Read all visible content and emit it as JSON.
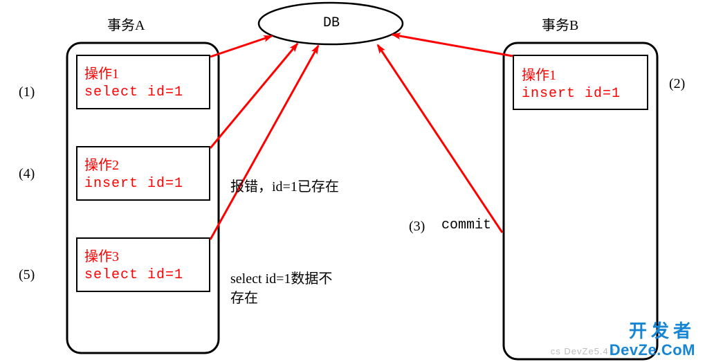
{
  "db": {
    "label": "DB"
  },
  "transaction_a": {
    "title": "事务A",
    "operations": [
      {
        "title": "操作1",
        "code": "select  id=1",
        "step_label": "(1)"
      },
      {
        "title": "操作2",
        "code": "insert  id=1",
        "step_label": "(4)",
        "annotation": "报错，id=1已存在"
      },
      {
        "title": "操作3",
        "code": "select  id=1",
        "step_label": "(5)",
        "annotation_lines": [
          "select id=1数据不",
          "存在"
        ]
      }
    ]
  },
  "transaction_b": {
    "title": "事务B",
    "operations": [
      {
        "title": "操作1",
        "code": "insert  id=1",
        "step_label": "(2)"
      }
    ],
    "commit": {
      "step_label": "(3)",
      "text": "commit"
    }
  },
  "watermark": {
    "chinese": "开发者",
    "latin": "DevZe.CoM",
    "csdn_like": "cs DevZe5.4 t"
  }
}
